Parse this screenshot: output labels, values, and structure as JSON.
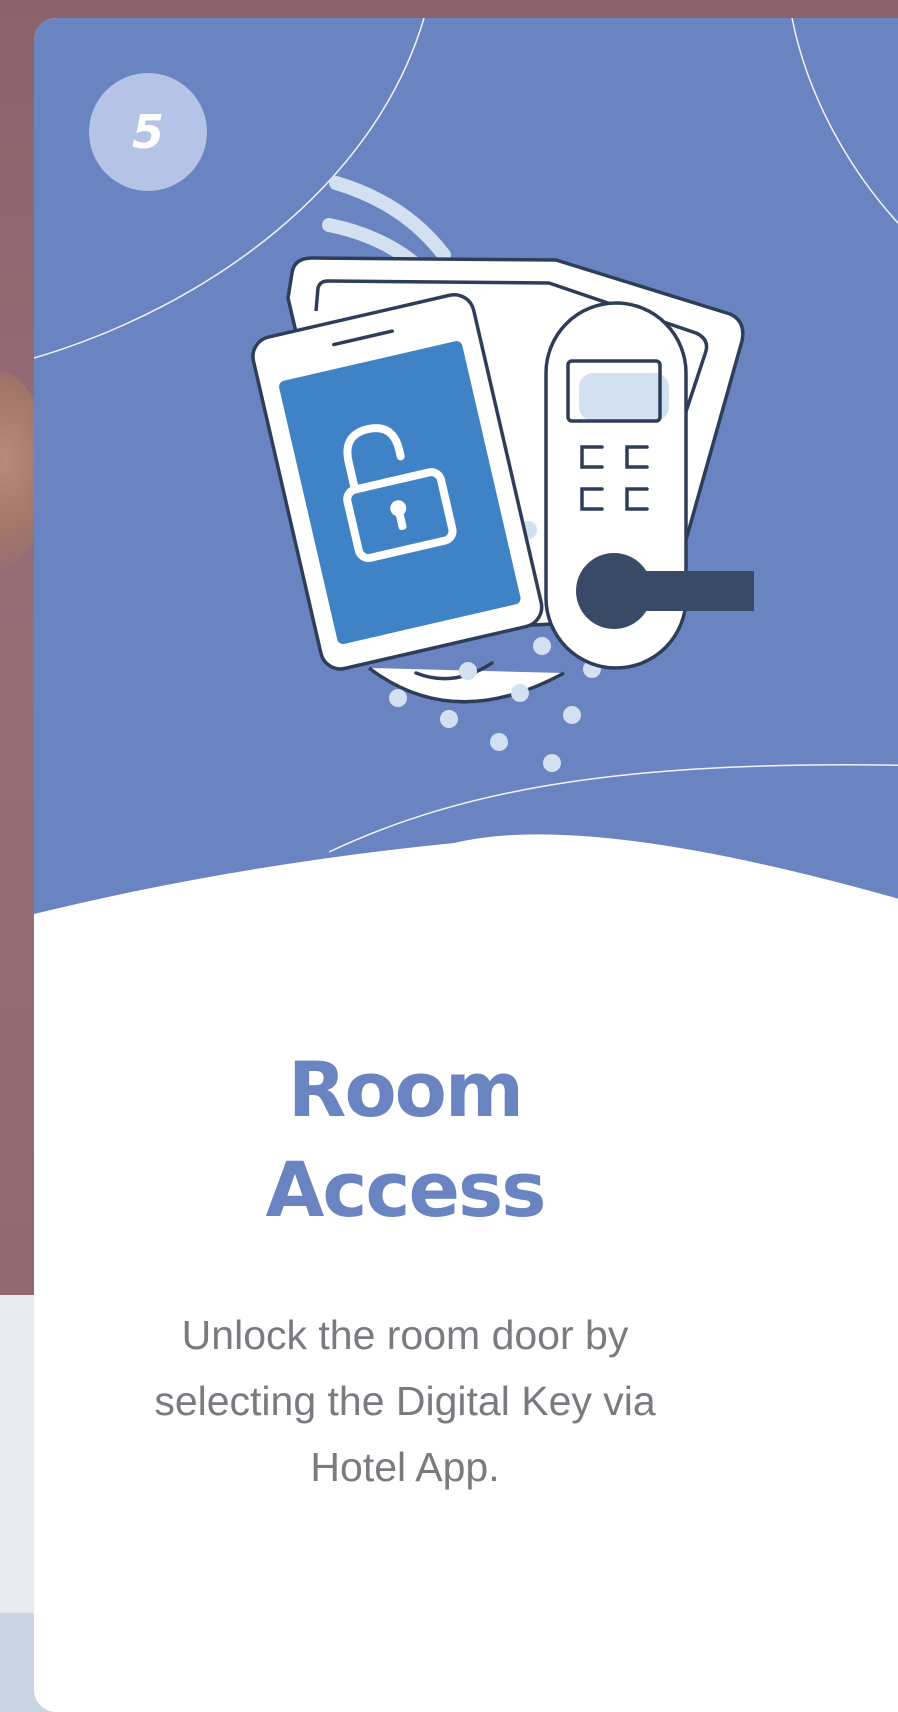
{
  "step": {
    "number": "5"
  },
  "card": {
    "title_line1": "Room",
    "title_line2": "Access",
    "description": "Unlock the room door by selecting the Digital Key via Hotel App."
  },
  "colors": {
    "hero_blue": "#6a84c2",
    "badge_blue": "#b5c3e6",
    "phone_screen": "#3f83c6",
    "outline_navy": "#2f3e58",
    "handle_navy": "#394a66",
    "accent_light": "#d3e0f1",
    "title_color": "#6a84c2",
    "text_gray": "#7a7b80"
  },
  "icons": {
    "illustration": "smartphone-unlock-smart-door-lock",
    "phone_icon": "open-padlock-icon",
    "signal_icon": "wireless-signal-icon"
  }
}
